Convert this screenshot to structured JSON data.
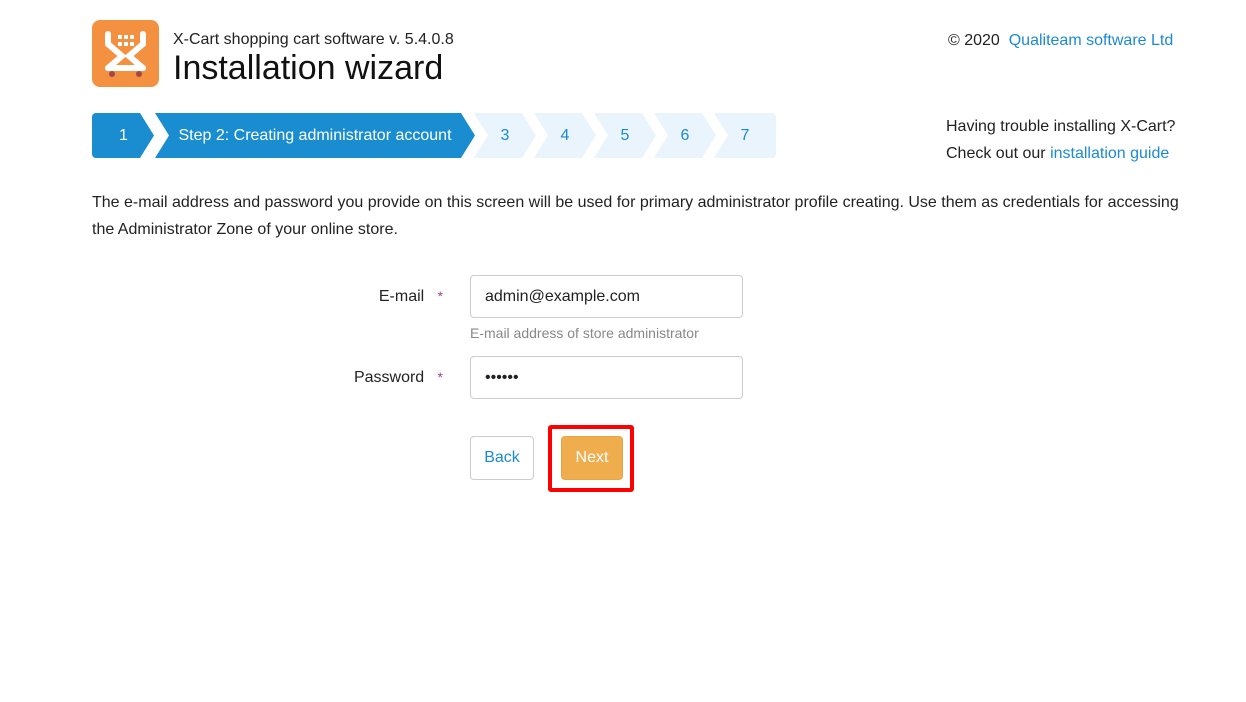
{
  "header": {
    "subtitle": "X-Cart shopping cart software v. 5.4.0.8",
    "title": "Installation wizard",
    "copyright": "© 2020",
    "company_link": "Qualiteam software Ltd",
    "logo_icon": "x-cart-logo",
    "logo_color": "#f39140"
  },
  "steps": [
    {
      "label": "1"
    },
    {
      "label": "Step 2: Creating administrator account"
    },
    {
      "label": "3"
    },
    {
      "label": "4"
    },
    {
      "label": "5"
    },
    {
      "label": "6"
    },
    {
      "label": "7"
    }
  ],
  "help": {
    "line1": "Having trouble installing X-Cart?",
    "line2_prefix": "Check out our",
    "link": "installation guide"
  },
  "description": "The e-mail address and password you provide on this screen will be used for primary administrator profile creating. Use them as credentials for accessing the Administrator Zone of your online store.",
  "form": {
    "email_label": "E-mail",
    "email_value": "admin@example.com",
    "email_hint": "E-mail address of store administrator",
    "password_label": "Password",
    "password_value": "123456",
    "required_mark": "*"
  },
  "buttons": {
    "back": "Back",
    "next": "Next"
  },
  "colors": {
    "accent": "#1a8dd1",
    "next_button": "#f0ad4e",
    "highlight": "#ff0000"
  }
}
